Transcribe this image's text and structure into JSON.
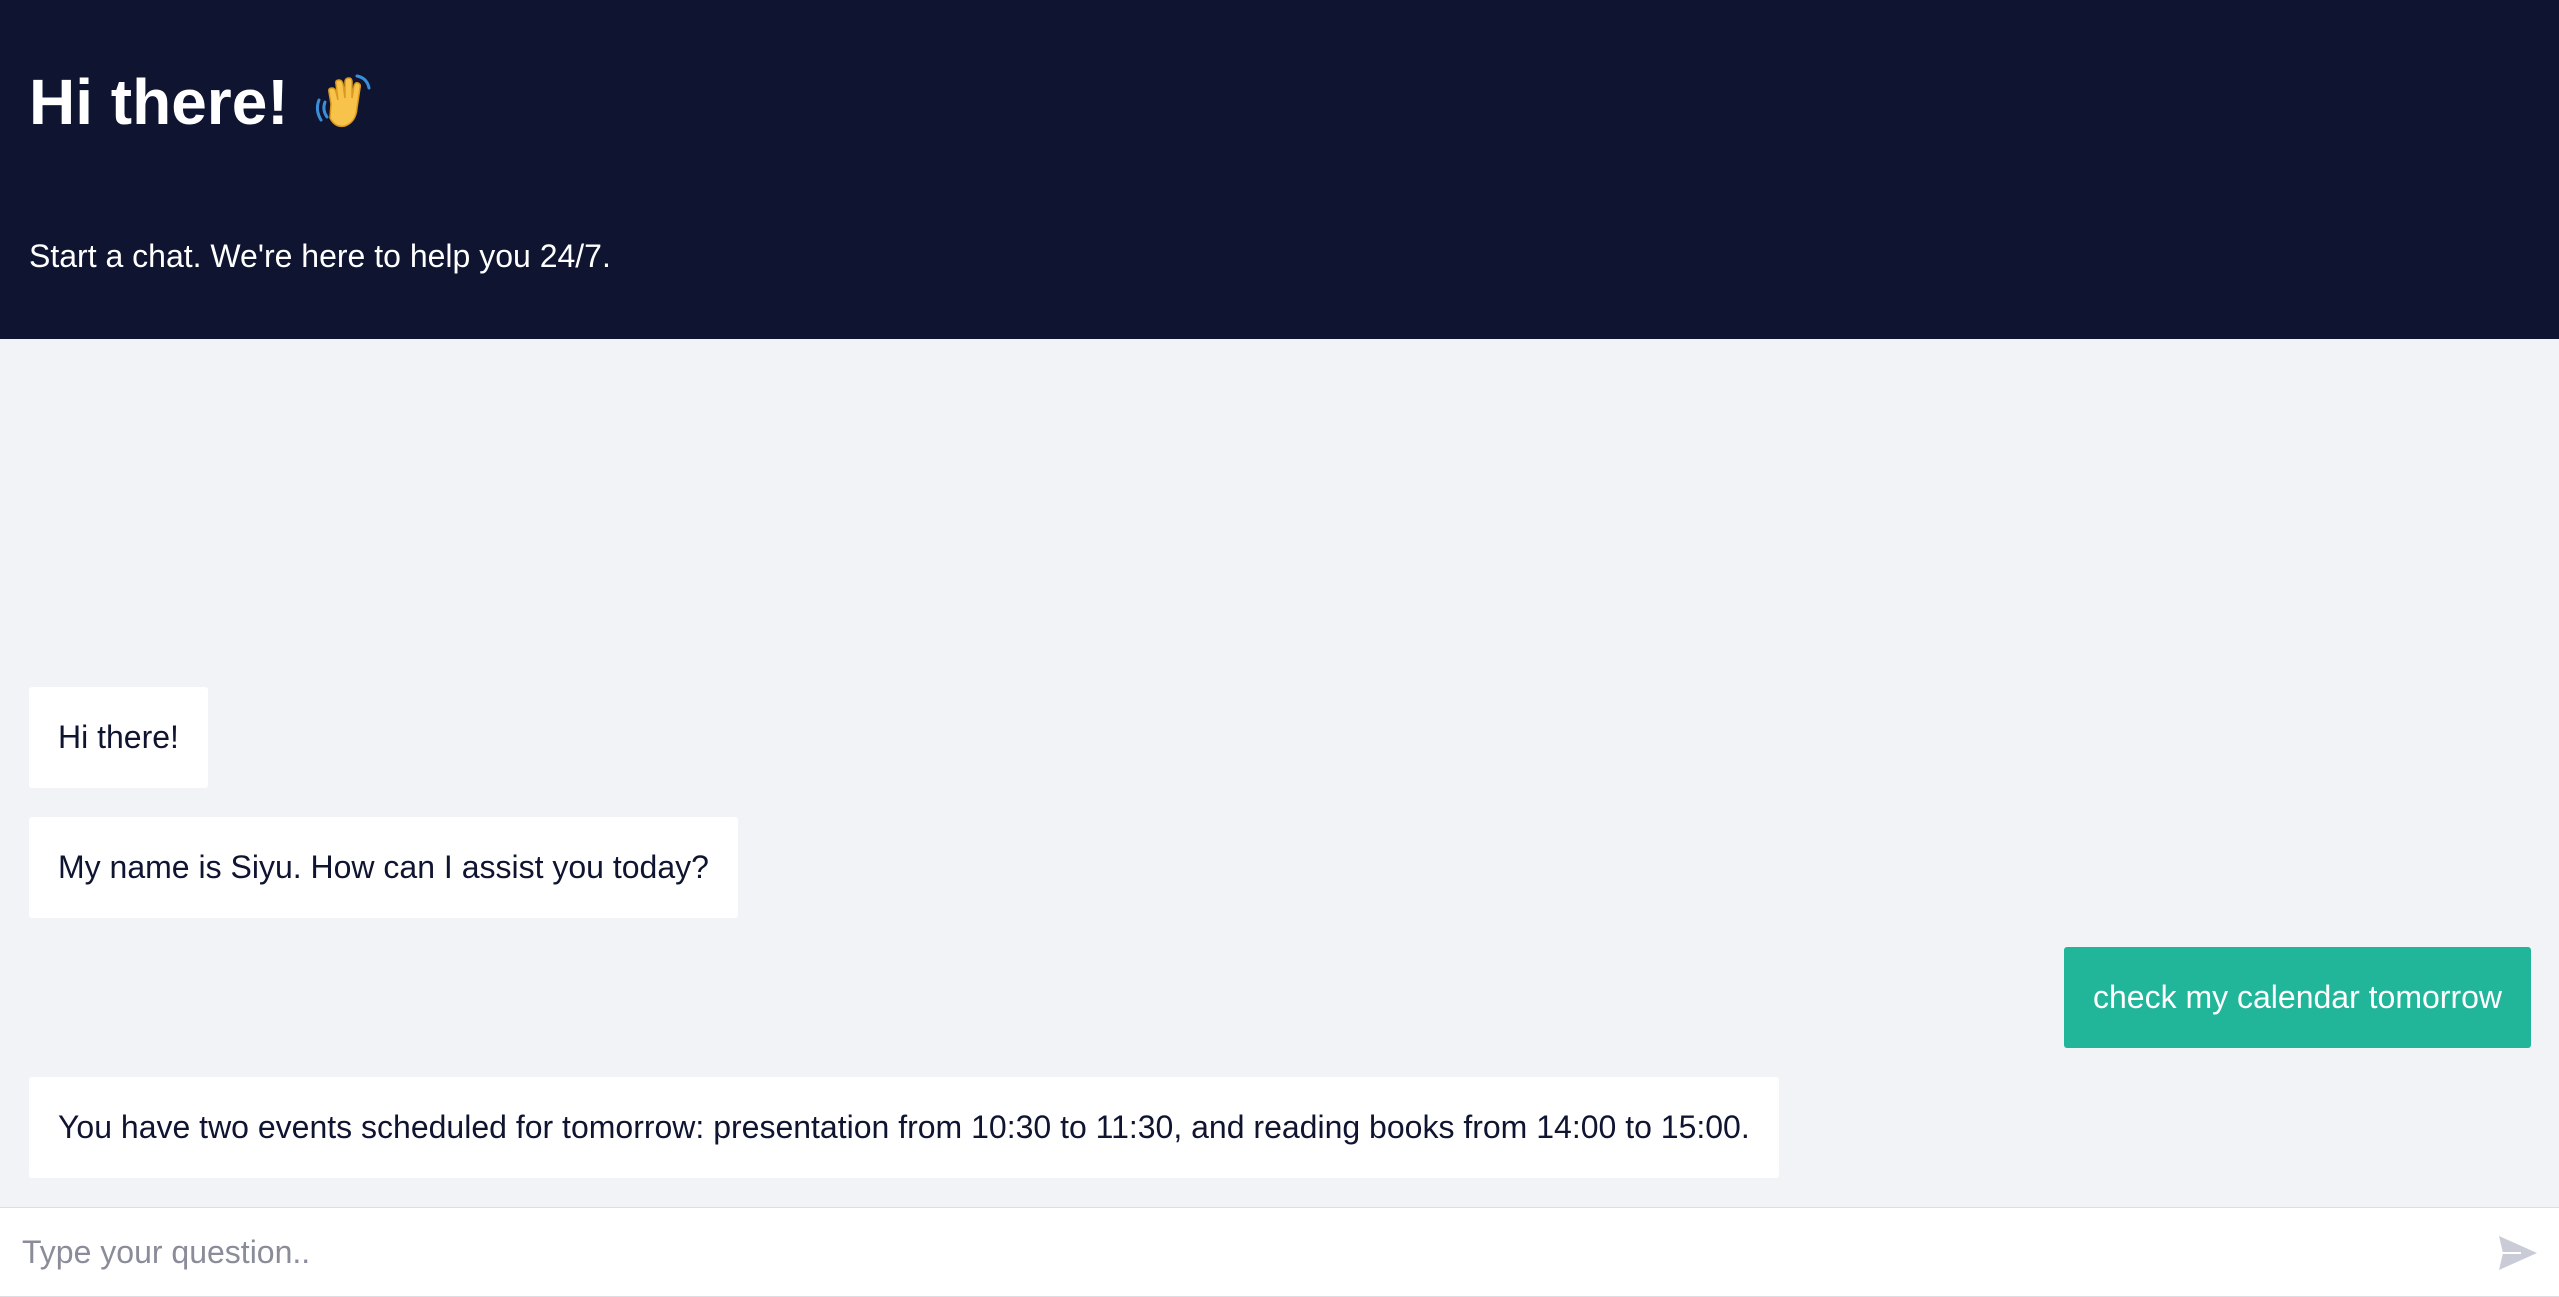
{
  "header": {
    "title": "Hi there!",
    "wave_icon": "waving-hand-icon",
    "subtitle": "Start a chat. We're here to help you 24/7."
  },
  "messages": [
    {
      "sender": "bot",
      "text": "Hi there!"
    },
    {
      "sender": "bot",
      "text": "My name is Siyu. How can I assist you today?"
    },
    {
      "sender": "user",
      "text": "check my calendar tomorrow"
    },
    {
      "sender": "bot",
      "text": "You have two events scheduled for tomorrow: presentation from 10:30 to 11:30, and reading books from 14:00 to 15:00."
    }
  ],
  "input": {
    "value": "",
    "placeholder": "Type your question..",
    "send_icon": "send-icon"
  },
  "colors": {
    "header_bg": "#0f1431",
    "chat_bg": "#f2f3f7",
    "user_bubble": "#21b69a",
    "bot_bubble": "#ffffff"
  }
}
